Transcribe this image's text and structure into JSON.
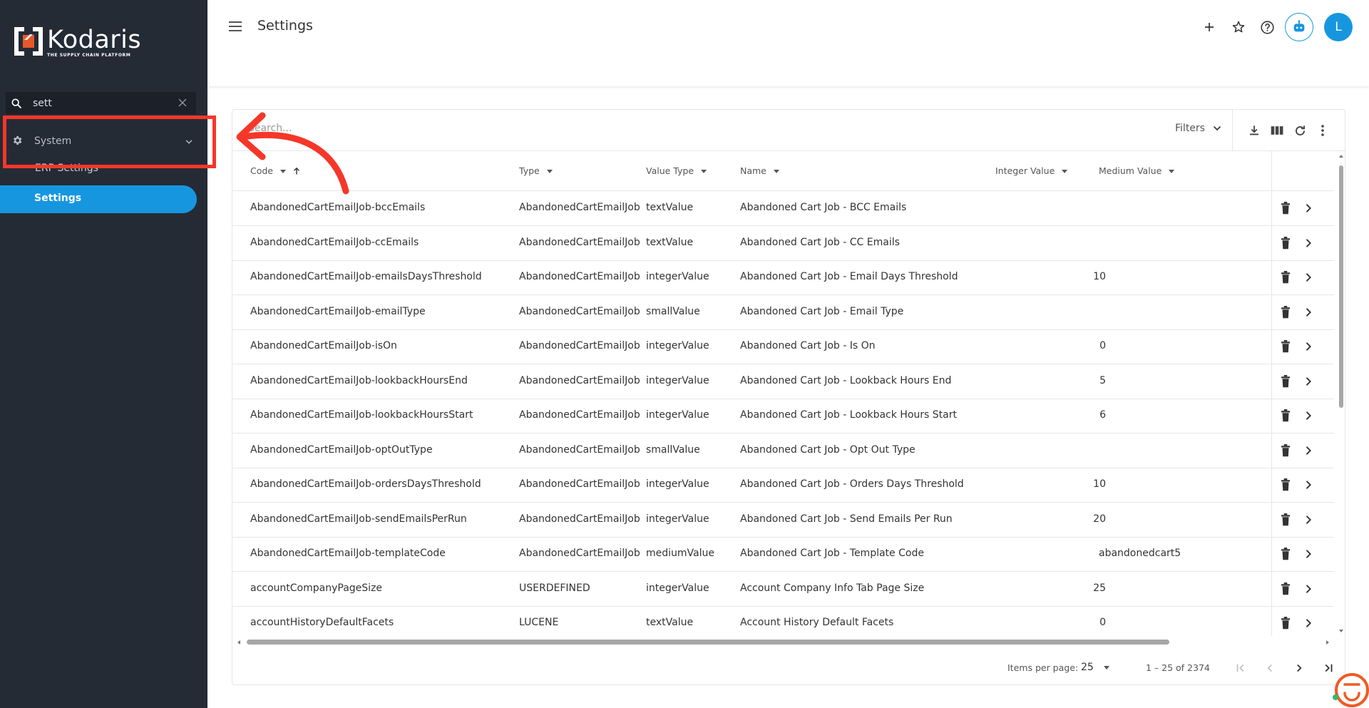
{
  "brand": {
    "name": "Kodaris",
    "tagline": "THE SUPPLY CHAIN PLATFORM"
  },
  "sidebar": {
    "search_value": "sett",
    "section_label": "System",
    "items": [
      {
        "label": "ERP Settings"
      },
      {
        "label": "Settings"
      }
    ]
  },
  "header": {
    "title": "Settings",
    "avatar_initial": "L"
  },
  "grid": {
    "search_placeholder": "Search...",
    "filters_label": "Filters",
    "columns": {
      "code": "Code",
      "type": "Type",
      "value_type": "Value Type",
      "name": "Name",
      "integer_value": "Integer Value",
      "medium_value": "Medium Value"
    },
    "rows": [
      {
        "code": "AbandonedCartEmailJob-bccEmails",
        "type": "AbandonedCartEmailJob",
        "value_type": "textValue",
        "name": "Abandoned Cart Job - BCC Emails",
        "integer_value": "",
        "medium_value": ""
      },
      {
        "code": "AbandonedCartEmailJob-ccEmails",
        "type": "AbandonedCartEmailJob",
        "value_type": "textValue",
        "name": "Abandoned Cart Job - CC Emails",
        "integer_value": "",
        "medium_value": ""
      },
      {
        "code": "AbandonedCartEmailJob-emailsDaysThreshold",
        "type": "AbandonedCartEmailJob",
        "value_type": "integerValue",
        "name": "Abandoned Cart Job - Email Days Threshold",
        "integer_value": "10",
        "medium_value": ""
      },
      {
        "code": "AbandonedCartEmailJob-emailType",
        "type": "AbandonedCartEmailJob",
        "value_type": "smallValue",
        "name": "Abandoned Cart Job - Email Type",
        "integer_value": "",
        "medium_value": ""
      },
      {
        "code": "AbandonedCartEmailJob-isOn",
        "type": "AbandonedCartEmailJob",
        "value_type": "integerValue",
        "name": "Abandoned Cart Job - Is On",
        "integer_value": "0",
        "medium_value": ""
      },
      {
        "code": "AbandonedCartEmailJob-lookbackHoursEnd",
        "type": "AbandonedCartEmailJob",
        "value_type": "integerValue",
        "name": "Abandoned Cart Job - Lookback Hours End",
        "integer_value": "5",
        "medium_value": ""
      },
      {
        "code": "AbandonedCartEmailJob-lookbackHoursStart",
        "type": "AbandonedCartEmailJob",
        "value_type": "integerValue",
        "name": "Abandoned Cart Job - Lookback Hours Start",
        "integer_value": "6",
        "medium_value": ""
      },
      {
        "code": "AbandonedCartEmailJob-optOutType",
        "type": "AbandonedCartEmailJob",
        "value_type": "smallValue",
        "name": "Abandoned Cart Job - Opt Out Type",
        "integer_value": "",
        "medium_value": ""
      },
      {
        "code": "AbandonedCartEmailJob-ordersDaysThreshold",
        "type": "AbandonedCartEmailJob",
        "value_type": "integerValue",
        "name": "Abandoned Cart Job - Orders Days Threshold",
        "integer_value": "10",
        "medium_value": ""
      },
      {
        "code": "AbandonedCartEmailJob-sendEmailsPerRun",
        "type": "AbandonedCartEmailJob",
        "value_type": "integerValue",
        "name": "Abandoned Cart Job - Send Emails Per Run",
        "integer_value": "20",
        "medium_value": ""
      },
      {
        "code": "AbandonedCartEmailJob-templateCode",
        "type": "AbandonedCartEmailJob",
        "value_type": "mediumValue",
        "name": "Abandoned Cart Job - Template Code",
        "integer_value": "",
        "medium_value": "abandonedcart5"
      },
      {
        "code": "accountCompanyPageSize",
        "type": "USERDEFINED",
        "value_type": "integerValue",
        "name": "Account Company Info Tab Page Size",
        "integer_value": "25",
        "medium_value": ""
      },
      {
        "code": "accountHistoryDefaultFacets",
        "type": "LUCENE",
        "value_type": "textValue",
        "name": "Account History Default Facets",
        "integer_value": "0",
        "medium_value": ""
      }
    ]
  },
  "paginator": {
    "items_per_page_label": "Items per page:",
    "items_per_page": "25",
    "range_label": "1 – 25 of 2374"
  },
  "colors": {
    "sidebar_bg": "#252b35",
    "accent": "#1796e0",
    "annotation": "#f5372a"
  }
}
